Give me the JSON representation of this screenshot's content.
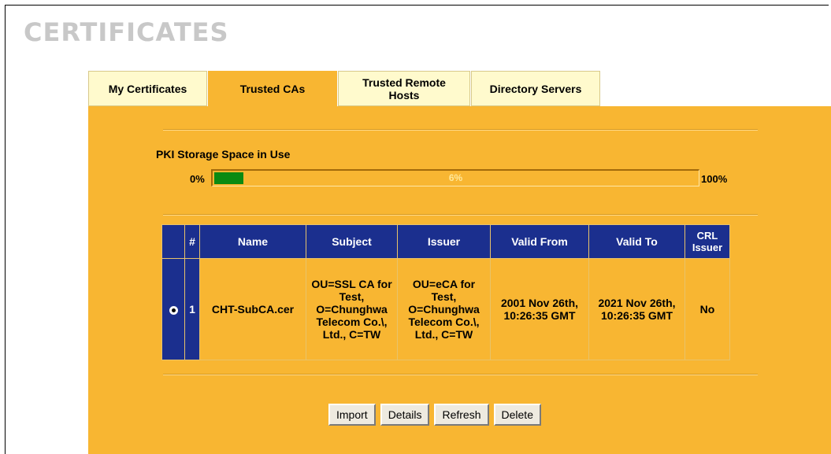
{
  "page": {
    "title": "CERTIFICATES"
  },
  "tabs": [
    {
      "label": "My Certificates",
      "active": false
    },
    {
      "label": "Trusted CAs",
      "active": true
    },
    {
      "label": "Trusted Remote Hosts",
      "active": false
    },
    {
      "label": "Directory Servers",
      "active": false
    }
  ],
  "storage": {
    "label": "PKI Storage Space in Use",
    "min_label": "0%",
    "max_label": "100%",
    "used_percent": 6,
    "used_text": "6%",
    "fill_color": "#0b8a12"
  },
  "table": {
    "headers": [
      "#",
      "Name",
      "Subject",
      "Issuer",
      "Valid From",
      "Valid To",
      "CRL Issuer"
    ],
    "rows": [
      {
        "selected": true,
        "index": "1",
        "name": "CHT-SubCA.cer",
        "subject": "OU=SSL CA for Test, O=Chunghwa Telecom Co.\\, Ltd., C=TW",
        "issuer": "OU=eCA for Test, O=Chunghwa Telecom Co.\\, Ltd., C=TW",
        "valid_from": "2001 Nov 26th, 10:26:35 GMT",
        "valid_to": "2021 Nov 26th, 10:26:35 GMT",
        "crl_issuer": "No"
      }
    ]
  },
  "buttons": {
    "import": "Import",
    "details": "Details",
    "refresh": "Refresh",
    "delete": "Delete"
  },
  "colors": {
    "panel": "#f8b632",
    "header": "#1b2f8e",
    "tab_inactive": "#fffacd"
  }
}
